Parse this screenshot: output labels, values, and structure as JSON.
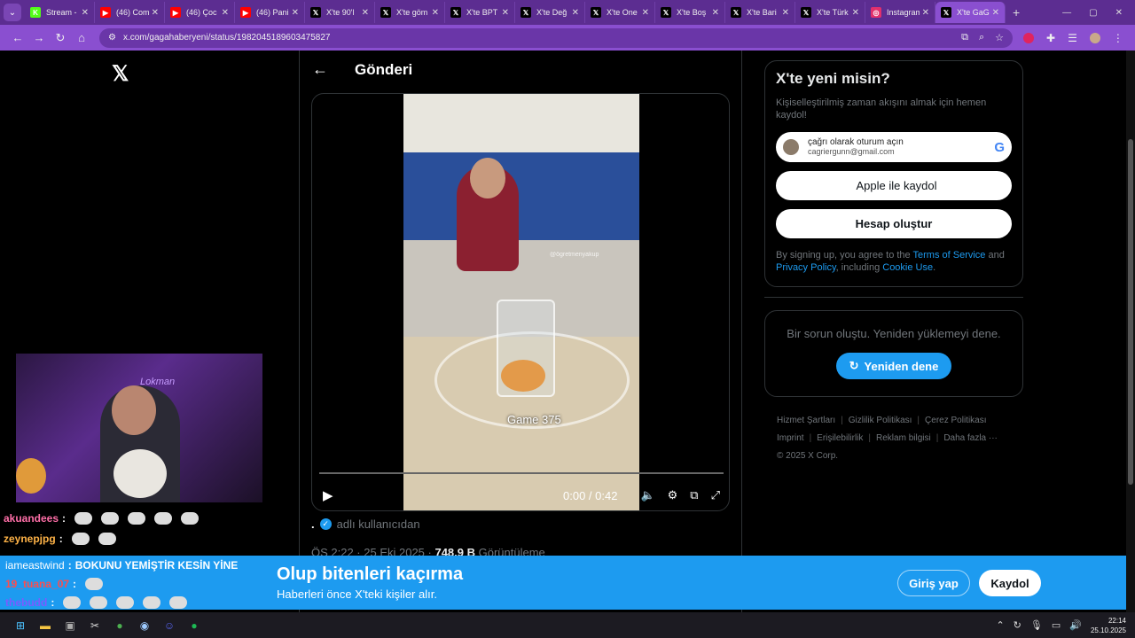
{
  "browser": {
    "tabs": [
      {
        "title": "Stream -",
        "icon": "kick-icon",
        "color": "#53fc18"
      },
      {
        "title": "(46) Com",
        "icon": "youtube-icon",
        "color": "#ff0000"
      },
      {
        "title": "(46) Çoc",
        "icon": "youtube-icon",
        "color": "#ff0000"
      },
      {
        "title": "(46) Pani",
        "icon": "youtube-icon",
        "color": "#ff0000"
      },
      {
        "title": "X'te 90'l",
        "icon": "x-icon",
        "color": "#000000"
      },
      {
        "title": "X'te göm",
        "icon": "x-icon",
        "color": "#000000"
      },
      {
        "title": "X'te BPT",
        "icon": "x-icon",
        "color": "#000000"
      },
      {
        "title": "X'te Değ",
        "icon": "x-icon",
        "color": "#000000"
      },
      {
        "title": "X'te One",
        "icon": "x-icon",
        "color": "#000000"
      },
      {
        "title": "X'te Boş",
        "icon": "x-icon",
        "color": "#000000"
      },
      {
        "title": "X'te Bari",
        "icon": "x-icon",
        "color": "#000000"
      },
      {
        "title": "X'te Türk",
        "icon": "x-icon",
        "color": "#000000"
      },
      {
        "title": "Instagram",
        "icon": "instagram-icon",
        "color": "#e1306c"
      },
      {
        "title": "X'te GaG",
        "icon": "x-icon",
        "color": "#000000"
      }
    ],
    "url": "x.com/gagahaberyeni/status/1982045189603475827"
  },
  "post": {
    "header_title": "Gönderi",
    "video_overlay_text": "Game 375",
    "video_watermark": "@ögretmenyakup",
    "time_display": "0:00 / 0:42",
    "author_prefix": ".",
    "author_name": "adlı kullanıcıdan",
    "meta_time": "ÖS 2:22 · 25 Eki 2025 · ",
    "views_count": "748.9 B",
    "views_label": " Görüntüleme"
  },
  "signup": {
    "title": "X'te yeni misin?",
    "subtitle": "Kişiselleştirilmiş zaman akışını almak için hemen kaydol!",
    "google_name": "çağrı olarak oturum açın",
    "google_email": "cagriergunn@gmail.com",
    "apple_label": "Apple ile kaydol",
    "create_label": "Hesap oluştur",
    "terms_pre": "By signing up, you agree to the ",
    "terms_link": "Terms of Service",
    "terms_and": " and ",
    "privacy_link": "Privacy Policy",
    "terms_including": ", including ",
    "cookie_link": "Cookie Use",
    "terms_end": "."
  },
  "error_card": {
    "message": "Bir sorun oluştu. Yeniden yüklemeyi dene.",
    "retry_label": "Yeniden dene"
  },
  "footer": {
    "links": [
      "Hizmet Şartları",
      "Gizlilik Politikası",
      "Çerez Politikası",
      "Imprint",
      "Erişilebilirlik",
      "Reklam bilgisi",
      "Daha fazla ···"
    ],
    "copyright": "© 2025 X Corp."
  },
  "stream_overlay": {
    "neon_sign": "Lokman",
    "chat": [
      {
        "user": "akuandees",
        "color": "#ff6fa8",
        "text": ""
      },
      {
        "user": "zeynepjpg",
        "color": "#ffb347",
        "text": ""
      },
      {
        "user": "iameastwind",
        "color": "#ffffff",
        "text": "BOKUNU YEMİŞTİR KESİN YİNE"
      },
      {
        "user": "19_tuana_07",
        "color": "#ff4d4d",
        "text": ""
      },
      {
        "user": "thebudd",
        "color": "#7a5cff",
        "text": ""
      }
    ]
  },
  "banner": {
    "title": "Olup bitenleri kaçırma",
    "subtitle": "Haberleri önce X'teki kişiler alır.",
    "login_label": "Giriş yap",
    "register_label": "Kaydol"
  },
  "taskbar": {
    "time": "22:14",
    "date": "25.10.2025"
  }
}
